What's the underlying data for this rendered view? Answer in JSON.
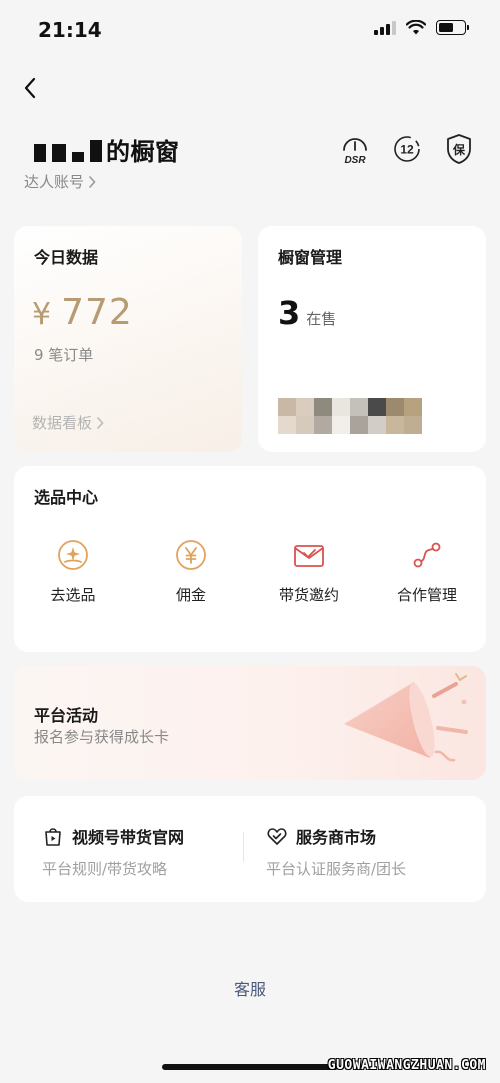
{
  "status_bar": {
    "time": "21:14"
  },
  "header": {
    "title_suffix": "的橱窗",
    "account_link": "达人账号"
  },
  "badges": [
    {
      "icon": "dsr-gauge-icon",
      "label": "DSR"
    },
    {
      "icon": "twelve-badge-icon",
      "label": "12"
    },
    {
      "icon": "shield-guarantee-icon",
      "label": "保"
    }
  ],
  "today_data": {
    "title": "今日数据",
    "currency": "¥",
    "amount": "772",
    "orders": "9 笔订单",
    "dashboard_link": "数据看板"
  },
  "window_mgmt": {
    "title": "橱窗管理",
    "count": "3",
    "count_label": "在售"
  },
  "select_center": {
    "title": "选品中心",
    "items": [
      {
        "label": "去选品",
        "icon": "select-product-icon"
      },
      {
        "label": "佣金",
        "icon": "commission-yen-icon"
      },
      {
        "label": "带货邀约",
        "icon": "invitation-envelope-icon"
      },
      {
        "label": "合作管理",
        "icon": "cooperation-link-icon"
      }
    ]
  },
  "activity": {
    "title": "平台活动",
    "subtitle": "报名参与获得成长卡"
  },
  "links": {
    "left": {
      "title": "视频号带货官网",
      "subtitle": "平台规则/带货攻略"
    },
    "right": {
      "title": "服务商市场",
      "subtitle": "平台认证服务商/团长"
    }
  },
  "footer": {
    "customer_service": "客服",
    "watermark": "GUOWAIWANGZHUAN.COM"
  },
  "colors": {
    "accent_gold": "#b79b72",
    "icon_orange": "#e0a25c",
    "icon_red": "#d9534f",
    "link_blue_gray": "#4a5a7a"
  }
}
